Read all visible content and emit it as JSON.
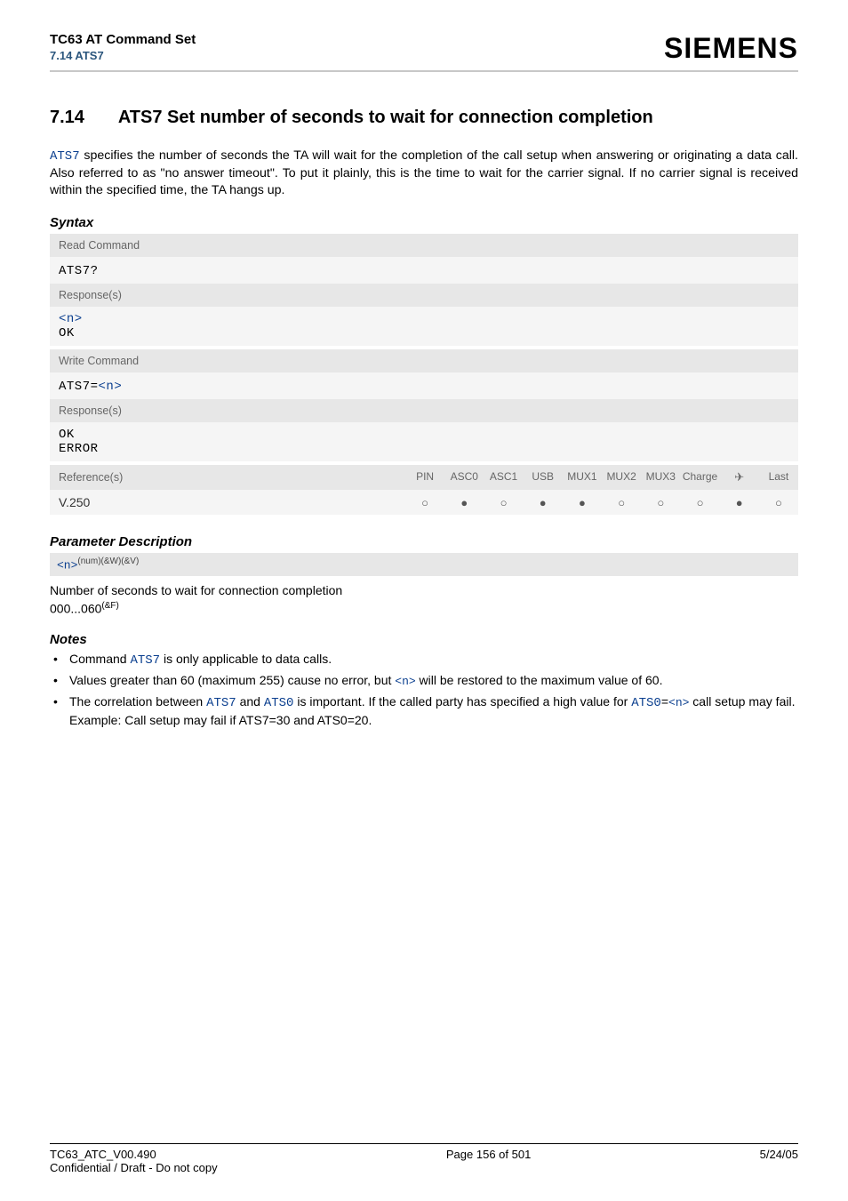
{
  "header": {
    "doc_title": "TC63 AT Command Set",
    "doc_sub": "7.14 ATS7",
    "brand": "SIEMENS"
  },
  "section": {
    "number": "7.14",
    "title": "ATS7   Set number of seconds to wait for connection completion"
  },
  "intro": {
    "link": "ATS7",
    "text": " specifies the number of seconds the TA will wait for the completion of the call setup when answering or originating a data call. Also referred to as \"no answer timeout\". To put it plainly, this is the time to wait for the carrier signal. If no carrier signal is received within the specified time, the TA hangs up."
  },
  "syntax": {
    "label": "Syntax",
    "read_label": "Read Command",
    "read_cmd": "ATS7?",
    "response_label": "Response(s)",
    "read_resp_n": "<n>",
    "read_resp_ok": "OK",
    "write_label": "Write Command",
    "write_cmd_prefix": "ATS7=",
    "write_cmd_param": "<n>",
    "write_resp_ok": "OK",
    "write_resp_err": "ERROR",
    "ref_label": "Reference(s)",
    "ref_value": "V.250",
    "columns": [
      "PIN",
      "ASC0",
      "ASC1",
      "USB",
      "MUX1",
      "MUX2",
      "MUX3",
      "Charge",
      "✈",
      "Last"
    ],
    "dots": [
      "○",
      "●",
      "○",
      "●",
      "●",
      "○",
      "○",
      "○",
      "●",
      "○"
    ]
  },
  "params": {
    "heading": "Parameter Description",
    "name": "<n>",
    "tags": "(num)(&W)(&V)",
    "desc": "Number of seconds to wait for connection completion",
    "range": "000...060",
    "range_sup": "(&F)"
  },
  "notes": {
    "heading": "Notes",
    "n1_a": "Command ",
    "n1_link": "ATS7",
    "n1_b": " is only applicable to data calls.",
    "n2_a": "Values greater than 60 (maximum 255) cause no error, but ",
    "n2_link": "<n>",
    "n2_b": " will be restored to the maximum value of 60.",
    "n3_a": "The correlation between ",
    "n3_link1": "ATS7",
    "n3_b": " and ",
    "n3_link2": "ATS0",
    "n3_c": " is important. If the called party has specified a high value for ",
    "n3_link3": "ATS0",
    "n3_eq": "=",
    "n3_link4": "<n>",
    "n3_d": " call setup may fail.",
    "n3_e": "Example: Call setup may fail if ATS7=30 and ATS0=20."
  },
  "footer": {
    "left1": "TC63_ATC_V00.490",
    "left2": "Confidential / Draft - Do not copy",
    "center": "Page 156 of 501",
    "right": "5/24/05"
  }
}
